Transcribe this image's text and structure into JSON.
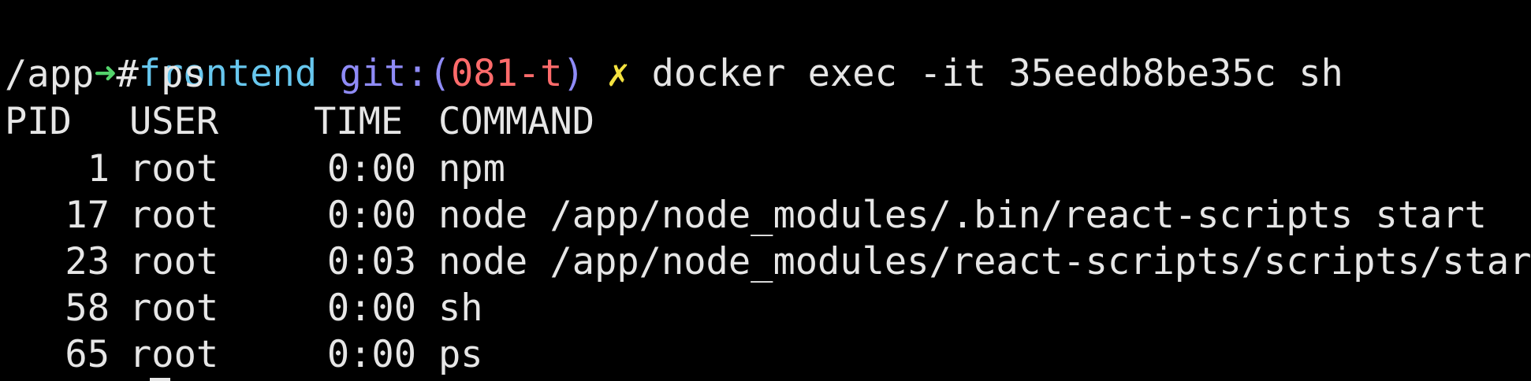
{
  "prompt": {
    "arrow": "➜",
    "dir": "frontend",
    "git_label": "git:(",
    "branch": "081-t",
    "git_close": ")",
    "dirty": "✗",
    "command": "docker exec -it 35eedb8be35c sh"
  },
  "shell_line": "/app # ps",
  "ps_table": {
    "headers": {
      "pid": "PID",
      "user": "USER",
      "time": "TIME",
      "command": "COMMAND"
    },
    "rows": [
      {
        "pid": "1",
        "user": "root",
        "time": "0:00",
        "command": "npm"
      },
      {
        "pid": "17",
        "user": "root",
        "time": "0:00",
        "command": "node /app/node_modules/.bin/react-scripts start"
      },
      {
        "pid": "23",
        "user": "root",
        "time": "0:03",
        "command": "node /app/node_modules/react-scripts/scripts/start.js"
      },
      {
        "pid": "58",
        "user": "root",
        "time": "0:00",
        "command": "sh"
      },
      {
        "pid": "65",
        "user": "root",
        "time": "0:00",
        "command": "ps"
      }
    ]
  },
  "colors": {
    "background": "#000000",
    "text": "#e6e6e6",
    "arrow": "#53d36b",
    "dir": "#67c7ee",
    "git": "#8f8bf7",
    "branch": "#ff6b6b",
    "dirty": "#f4e23f"
  }
}
